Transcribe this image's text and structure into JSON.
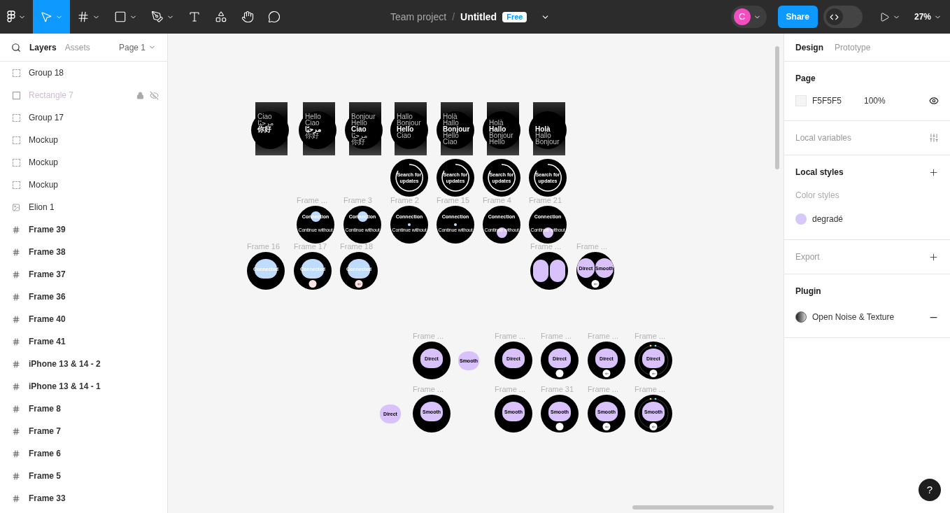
{
  "toolbar": {
    "tools": [
      {
        "kind": "main-menu",
        "selected": false,
        "menu": true
      },
      {
        "kind": "move",
        "selected": true,
        "menu": true
      },
      {
        "kind": "frame",
        "selected": false,
        "menu": true
      },
      {
        "kind": "shape",
        "selected": false,
        "menu": true
      },
      {
        "kind": "pen",
        "selected": false,
        "menu": true
      },
      {
        "kind": "text",
        "selected": false,
        "menu": false
      },
      {
        "kind": "resources",
        "selected": false,
        "menu": false
      },
      {
        "kind": "hand",
        "selected": false,
        "menu": false
      },
      {
        "kind": "comment",
        "selected": false,
        "menu": false
      }
    ],
    "team": "Team project",
    "separator": "/",
    "file": "Untitled",
    "plan": "Free",
    "avatar": "C",
    "share": "Share",
    "dev_mode": {
      "on": false
    },
    "zoom": "27%"
  },
  "layers_panel": {
    "tabs": [
      {
        "label": "Layers",
        "selected": true
      },
      {
        "label": "Assets",
        "selected": false
      }
    ],
    "page": "Page 1",
    "items": [
      {
        "kind": "group",
        "name": "Group 18",
        "locked": false,
        "hidden": false
      },
      {
        "kind": "rectangle",
        "name": "Rectangle 7",
        "locked": true,
        "hidden": true
      },
      {
        "kind": "group",
        "name": "Group 17",
        "locked": false,
        "hidden": false
      },
      {
        "kind": "group",
        "name": "Mockup",
        "locked": false,
        "hidden": false
      },
      {
        "kind": "group",
        "name": "Mockup",
        "locked": false,
        "hidden": false
      },
      {
        "kind": "group",
        "name": "Mockup",
        "locked": false,
        "hidden": false
      },
      {
        "kind": "image",
        "name": "Elion 1",
        "locked": false,
        "hidden": false
      },
      {
        "kind": "frame",
        "name": "Frame 39",
        "locked": false,
        "hidden": false
      },
      {
        "kind": "frame",
        "name": "Frame 38",
        "locked": false,
        "hidden": false
      },
      {
        "kind": "frame",
        "name": "Frame 37",
        "locked": false,
        "hidden": false
      },
      {
        "kind": "frame",
        "name": "Frame 36",
        "locked": false,
        "hidden": false
      },
      {
        "kind": "frame",
        "name": "Frame 40",
        "locked": false,
        "hidden": false
      },
      {
        "kind": "frame",
        "name": "Frame 41",
        "locked": false,
        "hidden": false
      },
      {
        "kind": "frame",
        "name": "iPhone 13 & 14 - 2",
        "locked": false,
        "hidden": false
      },
      {
        "kind": "frame",
        "name": "iPhone 13 & 14 - 1",
        "locked": false,
        "hidden": false
      },
      {
        "kind": "frame",
        "name": "Frame 8",
        "locked": false,
        "hidden": false
      },
      {
        "kind": "frame",
        "name": "Frame 7",
        "locked": false,
        "hidden": false
      },
      {
        "kind": "frame",
        "name": "Frame 6",
        "locked": false,
        "hidden": false
      },
      {
        "kind": "frame",
        "name": "Frame 5",
        "locked": false,
        "hidden": false
      },
      {
        "kind": "frame",
        "name": "Frame 33",
        "locked": false,
        "hidden": false
      }
    ]
  },
  "canvas": {
    "frames": [
      {
        "kind": "greeting",
        "lines": [
          {
            "text": "Ciao",
            "bold": false
          },
          {
            "text": "مرحبًا",
            "bold": false
          },
          {
            "text": "你好",
            "bold": true
          }
        ]
      },
      {
        "kind": "greeting",
        "lines": [
          {
            "text": "Hello",
            "bold": false
          },
          {
            "text": "Ciao",
            "bold": false
          },
          {
            "text": "مرحبًا",
            "bold": true
          },
          {
            "text": "你好",
            "bold": false
          }
        ]
      },
      {
        "kind": "greeting",
        "lines": [
          {
            "text": "Bonjour",
            "bold": false
          },
          {
            "text": "Hello",
            "bold": false
          },
          {
            "text": "Ciao",
            "bold": true
          },
          {
            "text": "مرحبًا",
            "bold": false
          },
          {
            "text": "你好",
            "bold": false
          }
        ]
      },
      {
        "kind": "greeting",
        "lines": [
          {
            "text": "Hallo",
            "bold": false
          },
          {
            "text": "Bonjour",
            "bold": false
          },
          {
            "text": "Hello",
            "bold": true
          },
          {
            "text": "Ciao",
            "bold": false
          }
        ]
      },
      {
        "kind": "greeting",
        "lines": [
          {
            "text": "Holà",
            "bold": false
          },
          {
            "text": "Hallo",
            "bold": false
          },
          {
            "text": "Bonjour",
            "bold": true
          },
          {
            "text": "Hello",
            "bold": false
          },
          {
            "text": "Ciao",
            "bold": false
          }
        ]
      },
      {
        "kind": "greeting",
        "lines": [
          {
            "text": "Holà",
            "bold": false
          },
          {
            "text": "Hallo",
            "bold": true
          },
          {
            "text": "Bonjour",
            "bold": false
          },
          {
            "text": "Hello",
            "bold": false
          }
        ]
      },
      {
        "kind": "greeting",
        "lines": [
          {
            "text": "Holà",
            "bold": true
          },
          {
            "text": "Hallo",
            "bold": false
          },
          {
            "text": "Bonjour",
            "bold": false
          }
        ]
      },
      {
        "kind": "search",
        "text": "Search for updates"
      },
      {
        "kind": "search",
        "text": "Search for updates"
      },
      {
        "kind": "search",
        "text": "Search for updates"
      },
      {
        "kind": "search",
        "text": "Search for updates"
      },
      {
        "kind": "connection",
        "label": "Frame ...",
        "title": "Connection",
        "subtitle": "Continue without",
        "indicator": {
          "kind": "top",
          "color": "#bfdbfe"
        }
      },
      {
        "kind": "connection",
        "label": "Frame 3",
        "title": "Connection",
        "subtitle": "Continue without",
        "indicator": {
          "kind": "top",
          "color": "#bfdbfe"
        }
      },
      {
        "kind": "connection",
        "label": "Frame 2",
        "title": "Connection",
        "subtitle": "Continue without",
        "indicator": {
          "kind": "center",
          "color": "#bfdbfe"
        }
      },
      {
        "kind": "connection",
        "label": "Frame 15",
        "title": "Connection",
        "subtitle": "Continue without",
        "indicator": {
          "kind": "center",
          "color": "#bfdbfe"
        }
      },
      {
        "kind": "connection",
        "label": "Frame 4",
        "title": "Connection",
        "subtitle": "Continue without",
        "indicator": {
          "kind": "bottom",
          "color": "#d9c2fb"
        }
      },
      {
        "kind": "connection",
        "label": "Frame 21",
        "title": "Connection",
        "subtitle": "Continue without",
        "indicator": {
          "kind": "bottom",
          "color": "#d9c2fb"
        }
      },
      {
        "kind": "connected",
        "label": "Frame 16",
        "text": "Connected"
      },
      {
        "kind": "connected",
        "label": "Frame 17",
        "text": "Connected",
        "button": {
          "kind": "blank"
        }
      },
      {
        "kind": "connected",
        "label": "Frame 18",
        "text": "Connected",
        "button": {
          "kind": "back"
        }
      },
      {
        "kind": "pair",
        "label": "Frame ..."
      },
      {
        "kind": "choice",
        "label": "Frame ...",
        "left": "Direct",
        "right": "Smooth",
        "button": {
          "kind": "back"
        }
      },
      {
        "kind": "single",
        "label": "Frame ...",
        "text": "Direct",
        "ring": false
      },
      {
        "kind": "blob",
        "text": "Smooth"
      },
      {
        "kind": "single",
        "label": "Frame ...",
        "text": "Direct",
        "ring": false
      },
      {
        "kind": "single",
        "label": "Frame ...",
        "text": "Direct",
        "button": {
          "kind": "blank"
        },
        "ring": false
      },
      {
        "kind": "single",
        "label": "Frame ...",
        "text": "Direct",
        "button": {
          "kind": "back"
        },
        "ring": false
      },
      {
        "kind": "single",
        "label": "Frame ...",
        "text": "Direct",
        "button": {
          "kind": "back"
        },
        "ring": true
      },
      {
        "kind": "blob",
        "text": "Direct"
      },
      {
        "kind": "single",
        "label": "Frame ...",
        "text": "Smooth",
        "ring": false
      },
      {
        "kind": "single",
        "label": "Frame ...",
        "text": "Smooth",
        "ring": false
      },
      {
        "kind": "single",
        "label": "Frame 31",
        "text": "Smooth",
        "button": {
          "kind": "blank"
        },
        "ring": false
      },
      {
        "kind": "single",
        "label": "Frame ...",
        "text": "Smooth",
        "button": {
          "kind": "back"
        },
        "ring": false
      },
      {
        "kind": "single",
        "label": "Frame ...",
        "text": "Smooth",
        "button": {
          "kind": "back"
        },
        "ring": true
      }
    ]
  },
  "design_panel": {
    "tabs": [
      {
        "label": "Design",
        "selected": true
      },
      {
        "label": "Prototype",
        "selected": false
      }
    ],
    "sections": [
      {
        "kind": "page",
        "title": "Page",
        "muted": false,
        "color": "#f5f5f5",
        "hex": "F5F5F5",
        "opacity": "100%"
      },
      {
        "kind": "plain",
        "title": "Local variables",
        "muted": true,
        "action": {
          "kind": "sliders"
        }
      },
      {
        "kind": "styles",
        "title": "Local styles",
        "muted": false,
        "action": {
          "kind": "plus"
        },
        "subtitle": "Color styles",
        "styles": [
          {
            "name": "degradé",
            "color": "#d6c8fb"
          }
        ]
      },
      {
        "kind": "plain",
        "title": "Export",
        "muted": true,
        "action": {
          "kind": "plus"
        }
      },
      {
        "kind": "plugins",
        "title": "Plugin",
        "muted": false,
        "plugins": [
          {
            "name": "Open Noise & Texture"
          }
        ]
      }
    ]
  },
  "help": "?"
}
